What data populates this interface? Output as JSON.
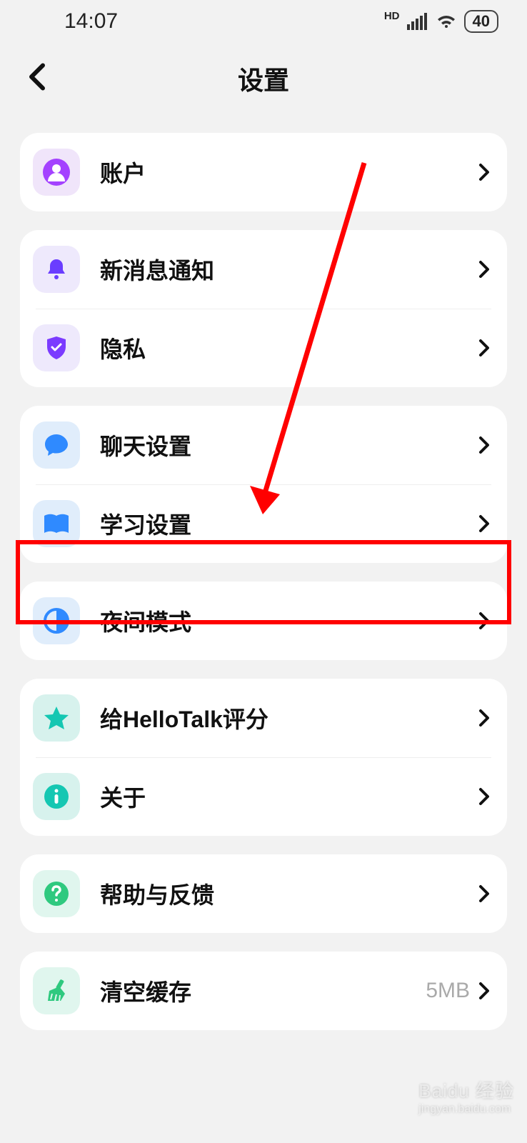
{
  "statusbar": {
    "time": "14:07",
    "battery": "40",
    "hd": "HD"
  },
  "header": {
    "title": "设置"
  },
  "groups": [
    {
      "rows": [
        {
          "label": "账户"
        }
      ]
    },
    {
      "rows": [
        {
          "label": "新消息通知"
        },
        {
          "label": "隐私"
        }
      ]
    },
    {
      "rows": [
        {
          "label": "聊天设置"
        },
        {
          "label": "学习设置"
        }
      ]
    },
    {
      "rows": [
        {
          "label": "夜间模式"
        }
      ]
    },
    {
      "rows": [
        {
          "label": "给HelloTalk评分"
        },
        {
          "label": "关于"
        }
      ]
    },
    {
      "rows": [
        {
          "label": "帮助与反馈"
        }
      ]
    },
    {
      "rows": [
        {
          "label": "清空缓存",
          "value": "5MB"
        }
      ]
    }
  ],
  "watermark": {
    "main": "Baidu 经验",
    "sub": "jingyan.baidu.com"
  }
}
